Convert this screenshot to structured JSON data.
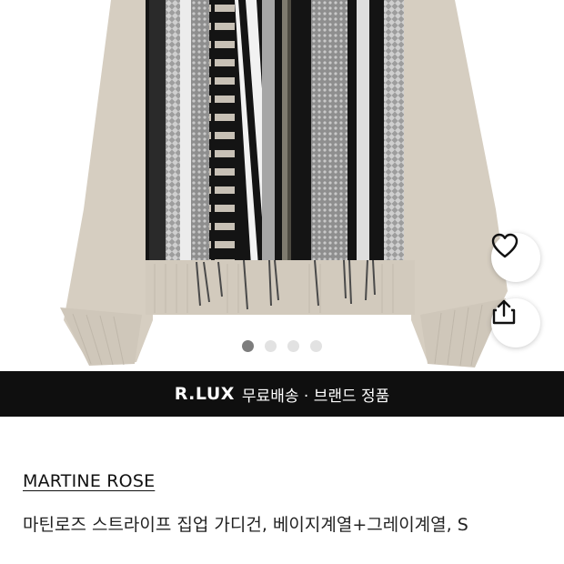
{
  "carousel": {
    "total_slides": 4,
    "active_index": 0
  },
  "actions": {
    "wishlist_icon": "heart-outline-icon",
    "share_icon": "share-icon"
  },
  "banner": {
    "brand": "R.LUX",
    "text": "무료배송 · 브랜드 정품",
    "background": "#0f0f0f",
    "text_color": "#ffffff"
  },
  "product": {
    "brand": "MARTINE ROSE",
    "title": "마틴로즈 스트라이프 집업 가디건, 베이지계열+그레이계열, S"
  },
  "colors": {
    "garment_beige": "#d4ccbf",
    "stripe_black": "#141414",
    "stripe_grey": "#9a9a9a"
  }
}
